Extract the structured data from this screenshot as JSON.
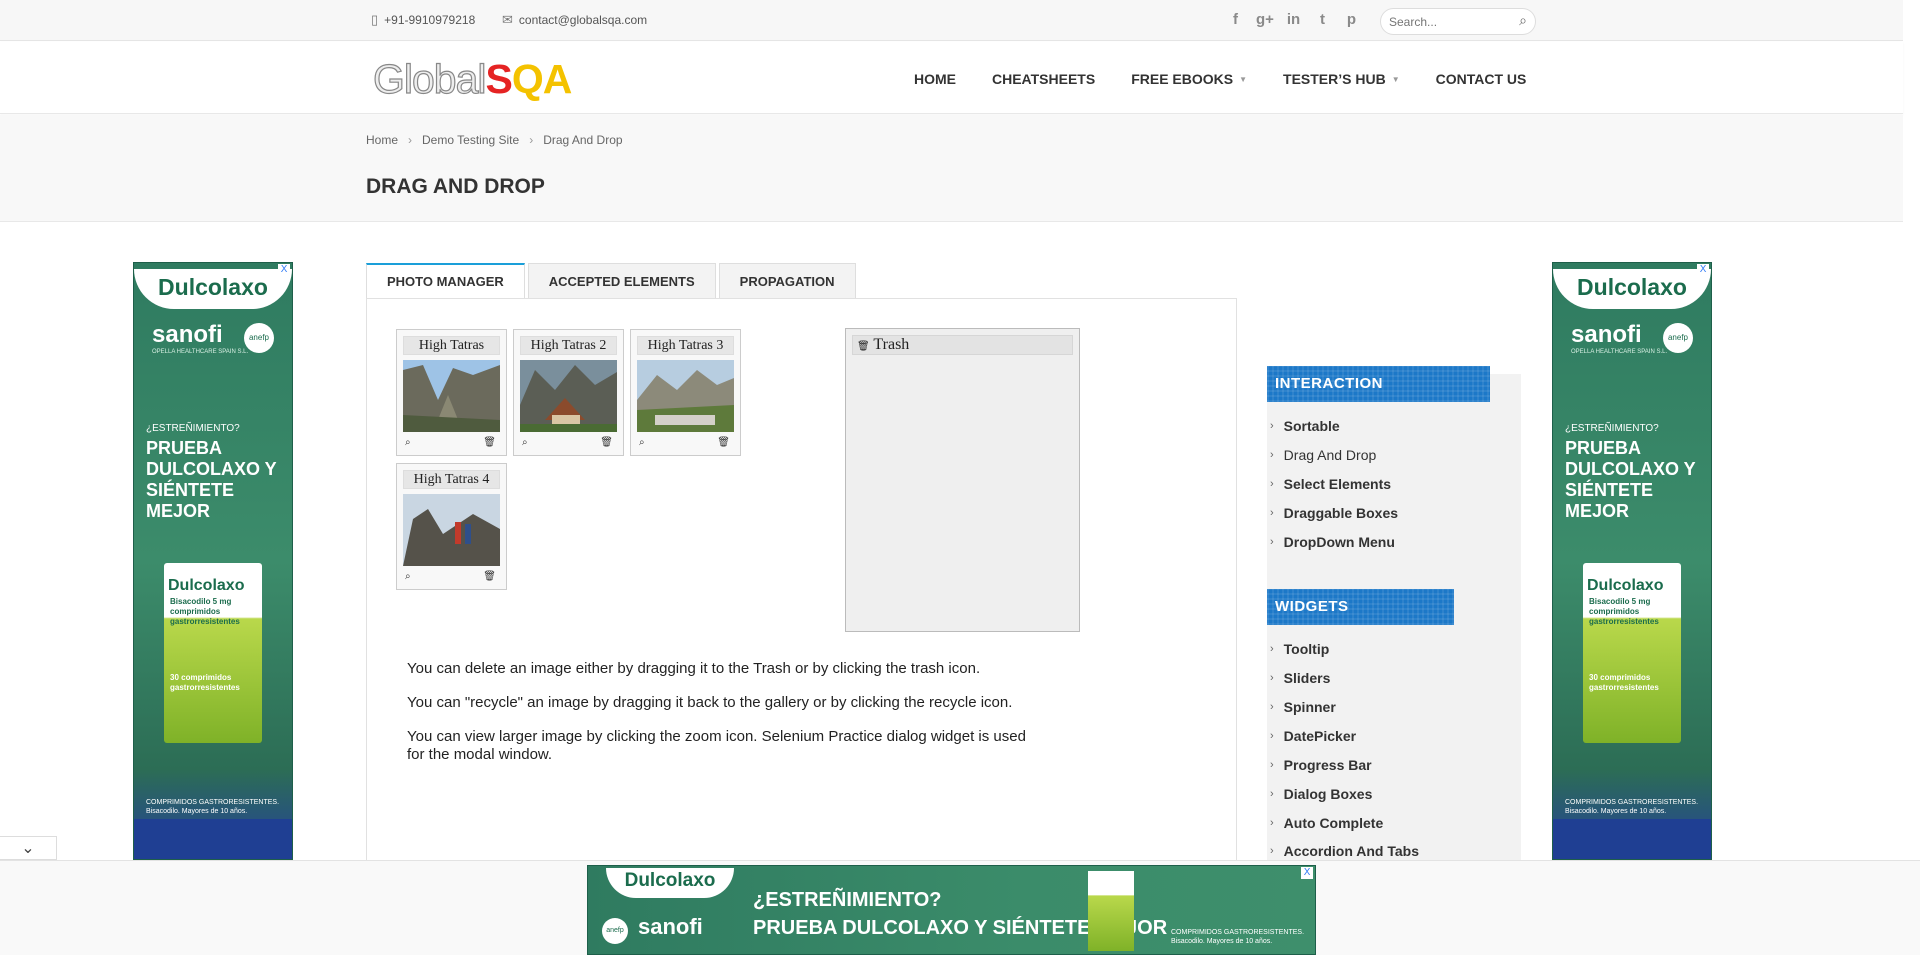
{
  "topbar": {
    "phone": "+91-9910979218",
    "email": "contact@globalsqa.com",
    "social_icons": [
      "f",
      "g+",
      "in",
      "t",
      "p"
    ],
    "search_placeholder": "Search..."
  },
  "header": {
    "logo_part1": "Global",
    "logo_part2": "S",
    "logo_part3": "QA",
    "nav": [
      {
        "label": "HOME"
      },
      {
        "label": "CHEATSHEETS"
      },
      {
        "label": "FREE EBOOKS"
      },
      {
        "label": "TESTER’S HUB"
      },
      {
        "label": "CONTACT US"
      }
    ]
  },
  "breadcrumb": [
    "Home",
    "Demo Testing Site",
    "Drag And Drop"
  ],
  "page_title": "DRAG AND DROP",
  "tabs": [
    "PHOTO MANAGER",
    "ACCEPTED ELEMENTS",
    "PROPAGATION"
  ],
  "gallery": [
    {
      "title": "High Tatras"
    },
    {
      "title": "High Tatras 2"
    },
    {
      "title": "High Tatras 3"
    },
    {
      "title": "High Tatras 4"
    }
  ],
  "trash_label": "Trash",
  "descriptions": [
    "You can delete an image either by dragging it to the Trash or by clicking the trash icon.",
    "You can \"recycle\" an image by dragging it back to the gallery or by clicking the recycle icon.",
    "You can view larger image by clicking the zoom icon. Selenium Practice dialog widget is used for the modal window."
  ],
  "sidebar": {
    "interaction_title": "INTERACTION",
    "interaction_items": [
      "Sortable",
      "Drag And Drop",
      "Select Elements",
      "Draggable Boxes",
      "DropDown Menu"
    ],
    "widgets_title": "WIDGETS",
    "widget_items": [
      "Tooltip",
      "Sliders",
      "Spinner",
      "DatePicker",
      "Progress Bar",
      "Dialog Boxes",
      "Auto Complete",
      "Accordion And Tabs"
    ]
  },
  "ads": {
    "brand": "Dulcolaxo",
    "company": "sanofi",
    "company_sub": "OPELLA HEALTHCARE SPAIN S.L.",
    "badge": "anefp",
    "question": "¿ESTREÑIMIENTO?",
    "headline_side": "PRUEBA DULCOLAXO Y SIÉNTETE MEJOR",
    "headline_bottom_1": "¿ESTREÑIMIENTO?",
    "headline_bottom_2": "PRUEBA DULCOLAXO Y SIÉNTETE MEJOR",
    "box_brand": "Dulcolaxo",
    "box_sub": "Bisacodilo 5 mg comprimidos gastrorresistentes",
    "box_count": "30 comprimidos gastrorresistentes",
    "footer": "COMPRIMIDOS GASTRORESISTENTES. Bisacodilo. Mayores de 10 años.",
    "close": "X"
  },
  "colors": {
    "accent_blue": "#1c78c8",
    "tab_active_border": "#1a9fd9",
    "logo_red": "#e52323",
    "logo_yellow": "#f4c200"
  }
}
